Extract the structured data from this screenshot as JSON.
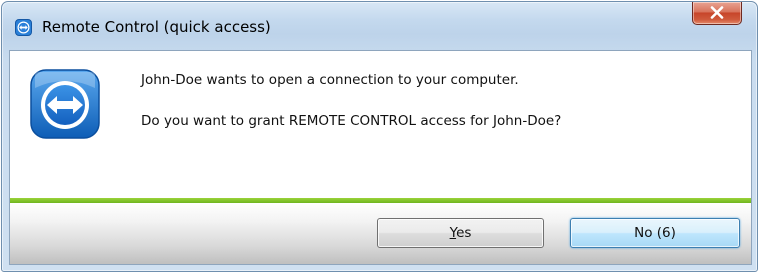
{
  "window": {
    "title": "Remote Control (quick access)",
    "icon": "teamviewer-icon",
    "close_icon": "close-icon"
  },
  "dialog": {
    "logo": "teamviewer-logo",
    "message_line_1": "John-Doe wants to open a connection to your computer.",
    "message_line_2": "Do you want to grant REMOTE CONTROL access for John-Doe?"
  },
  "buttons": {
    "yes_mnemonic": "Y",
    "yes_rest": "es",
    "no_label": "No (6)"
  },
  "colors": {
    "accent_bar": "#7ac02a",
    "close_button": "#c7452a",
    "brand_blue": "#1e73d2"
  }
}
